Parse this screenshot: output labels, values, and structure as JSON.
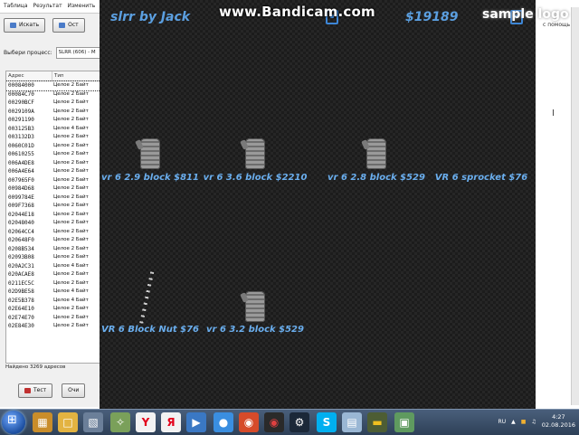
{
  "scanner": {
    "menu": [
      "Таблица",
      "Результат",
      "Изменить",
      "П"
    ],
    "search_button": "Искать",
    "stop_button": "Ост",
    "process_label": "Выбери процесс:",
    "process_value": "SLRR (606) - M",
    "columns": [
      "Адрес",
      "Тип"
    ],
    "rows": [
      {
        "addr": "00084000",
        "type": "Целое 2 Байт"
      },
      {
        "addr": "00084C70",
        "type": "Целое 2 Байт"
      },
      {
        "addr": "00290BCF",
        "type": "Целое 2 Байт"
      },
      {
        "addr": "0029109A",
        "type": "Целое 2 Байт"
      },
      {
        "addr": "00291190",
        "type": "Целое 2 Байт"
      },
      {
        "addr": "003125B3",
        "type": "Целое 4 Байт"
      },
      {
        "addr": "003132D3",
        "type": "Целое 2 Байт"
      },
      {
        "addr": "0060C01D",
        "type": "Целое 2 Байт"
      },
      {
        "addr": "00610255",
        "type": "Целое 2 Байт"
      },
      {
        "addr": "006A4DE8",
        "type": "Целое 2 Байт"
      },
      {
        "addr": "006A4E64",
        "type": "Целое 2 Байт"
      },
      {
        "addr": "007965F0",
        "type": "Целое 2 Байт"
      },
      {
        "addr": "00984D68",
        "type": "Целое 2 Байт"
      },
      {
        "addr": "0099784E",
        "type": "Целое 2 Байт"
      },
      {
        "addr": "009F7368",
        "type": "Целое 2 Байт"
      },
      {
        "addr": "02044E18",
        "type": "Целое 2 Байт"
      },
      {
        "addr": "02048040",
        "type": "Целое 2 Байт"
      },
      {
        "addr": "02064CC4",
        "type": "Целое 2 Байт"
      },
      {
        "addr": "020648F0",
        "type": "Целое 2 Байт"
      },
      {
        "addr": "0208B534",
        "type": "Целое 2 Байт"
      },
      {
        "addr": "02093B08",
        "type": "Целое 2 Байт"
      },
      {
        "addr": "020A2C31",
        "type": "Целое 4 Байт"
      },
      {
        "addr": "020ACAE8",
        "type": "Целое 2 Байт"
      },
      {
        "addr": "0211EC5C",
        "type": "Целое 2 Байт"
      },
      {
        "addr": "02D9BE58",
        "type": "Целое 4 Байт"
      },
      {
        "addr": "02E5B378",
        "type": "Целое 4 Байт"
      },
      {
        "addr": "02E64E10",
        "type": "Целое 2 Байт"
      },
      {
        "addr": "02E74E70",
        "type": "Целое 2 Байт"
      },
      {
        "addr": "02E84E30",
        "type": "Целое 2 Байт"
      }
    ],
    "found_text": "Найдено 3269 адресов",
    "test_button": "Тест",
    "other_button": "Очи"
  },
  "right_window": {
    "hint": "с помощь"
  },
  "game": {
    "title": "slrr by Jack",
    "money": "$19189",
    "parts": [
      {
        "label": "vr 6 2.9 block $811"
      },
      {
        "label": "vr 6 3.6 block $2210"
      },
      {
        "label": "vr 6 2.8 block $529"
      },
      {
        "label": "VR 6 sprocket $76"
      },
      {
        "label": "VR 6 Block Nut $76"
      },
      {
        "label": "vr 6 3.2 block $529"
      }
    ]
  },
  "watermarks": {
    "bandicam": "www.Bandicam.com",
    "sample": "sample logo"
  },
  "taskbar": {
    "lang": "RU",
    "time": "4:27",
    "date": "02.08.2016",
    "icons": [
      "explorer-icon",
      "folder-icon",
      "calculator-icon",
      "yandex-icon",
      "yandex-browser-icon",
      "media-icon",
      "chrome-icon",
      "game-icon",
      "steam-icon",
      "skype-icon",
      "notepad-icon",
      "car-icon",
      "clipboard-icon"
    ],
    "colors": {
      "yandex": "#e2001a",
      "skype": "#00aff0",
      "steam": "#1b2838"
    }
  }
}
